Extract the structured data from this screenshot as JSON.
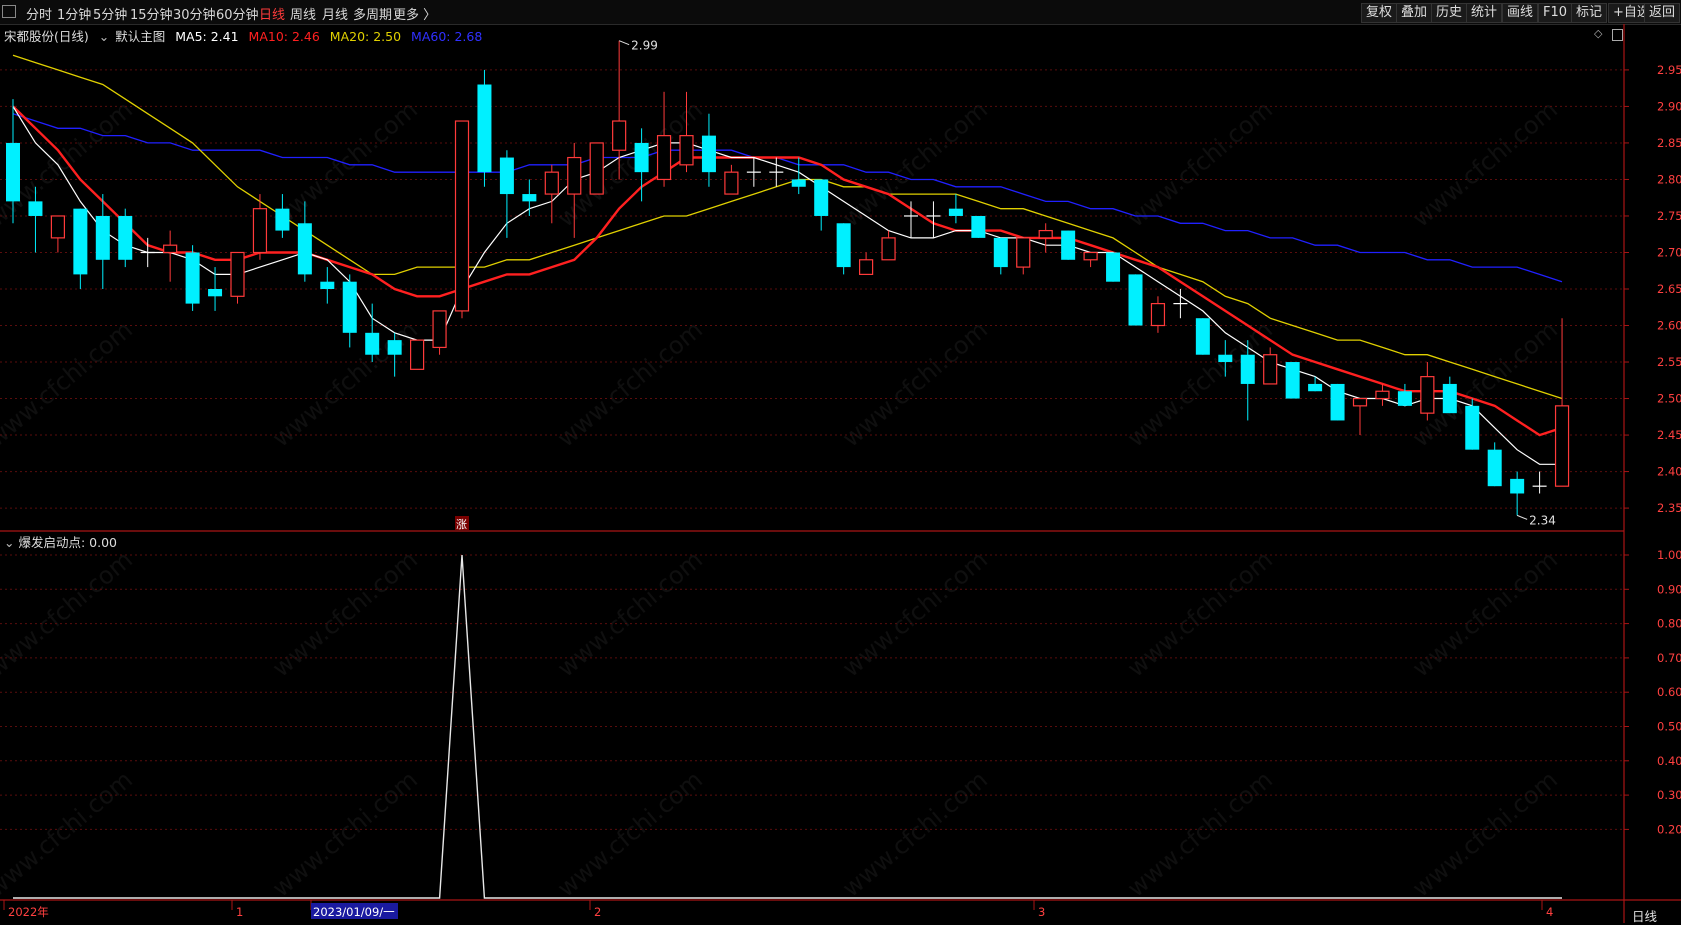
{
  "toolbar": {
    "left_items": [
      "分时",
      "1分钟",
      "5分钟",
      "15分钟",
      "30分钟",
      "60分钟",
      "日线",
      "周线",
      "月线",
      "多周期",
      "更多 〉"
    ],
    "active_item": "日线",
    "right_items": [
      "复权",
      "叠加",
      "历史",
      "统计",
      "画线",
      "F10",
      "标记",
      "+自选",
      "返回"
    ]
  },
  "main_legend": {
    "stock": "宋都股份",
    "period": "(日线)",
    "template": "默认主图",
    "ma5": "MA5: 2.41",
    "ma10": "MA10: 2.46",
    "ma20": "MA20: 2.50",
    "ma60": "MA60: 2.68"
  },
  "indicator_legend": {
    "name": "爆发启动点",
    "value": ": 0.00"
  },
  "annotations": {
    "high_label": "2.99",
    "low_label": "2.34",
    "signal_tag": "涨"
  },
  "x_axis": {
    "labels": [
      "2022年",
      "1",
      "2023/01/09/一",
      "2",
      "3",
      "4"
    ]
  },
  "timeframe_tag": "日线",
  "watermark": "www.cfchi.com",
  "colors": {
    "up": "#ff3a3a",
    "down": "#00f0ff",
    "ma5": "#ffffff",
    "ma10": "#ff2020",
    "ma20": "#e0d000",
    "ma60": "#2020ff",
    "axis": "#aa1515"
  },
  "chart_data": [
    {
      "type": "candlestick",
      "title": "宋都股份 (日线)",
      "y_ticks": [
        2.35,
        2.4,
        2.45,
        2.5,
        2.55,
        2.6,
        2.65,
        2.7,
        2.75,
        2.8,
        2.85,
        2.9,
        2.95
      ],
      "ylim": [
        2.32,
        2.98
      ],
      "candles": [
        [
          2.85,
          2.91,
          2.74,
          2.77
        ],
        [
          2.77,
          2.79,
          2.7,
          2.75
        ],
        [
          2.72,
          2.75,
          2.7,
          2.75
        ],
        [
          2.76,
          2.76,
          2.65,
          2.67
        ],
        [
          2.75,
          2.78,
          2.65,
          2.69
        ],
        [
          2.75,
          2.76,
          2.68,
          2.69
        ],
        [
          2.7,
          2.72,
          2.68,
          2.7
        ],
        [
          2.7,
          2.73,
          2.66,
          2.71
        ],
        [
          2.7,
          2.71,
          2.62,
          2.63
        ],
        [
          2.65,
          2.68,
          2.62,
          2.64
        ],
        [
          2.64,
          2.7,
          2.63,
          2.7
        ],
        [
          2.7,
          2.78,
          2.69,
          2.76
        ],
        [
          2.76,
          2.78,
          2.72,
          2.73
        ],
        [
          2.74,
          2.77,
          2.66,
          2.67
        ],
        [
          2.66,
          2.68,
          2.63,
          2.65
        ],
        [
          2.66,
          2.67,
          2.57,
          2.59
        ],
        [
          2.59,
          2.63,
          2.55,
          2.56
        ],
        [
          2.58,
          2.59,
          2.53,
          2.56
        ],
        [
          2.54,
          2.58,
          2.54,
          2.58
        ],
        [
          2.57,
          2.62,
          2.56,
          2.62
        ],
        [
          2.62,
          2.88,
          2.61,
          2.88
        ],
        [
          2.93,
          2.95,
          2.79,
          2.81
        ],
        [
          2.83,
          2.84,
          2.72,
          2.78
        ],
        [
          2.78,
          2.8,
          2.75,
          2.77
        ],
        [
          2.78,
          2.82,
          2.74,
          2.81
        ],
        [
          2.78,
          2.85,
          2.72,
          2.83
        ],
        [
          2.78,
          2.85,
          2.78,
          2.85
        ],
        [
          2.84,
          2.99,
          2.8,
          2.88
        ],
        [
          2.85,
          2.87,
          2.77,
          2.81
        ],
        [
          2.8,
          2.92,
          2.79,
          2.86
        ],
        [
          2.82,
          2.92,
          2.81,
          2.86
        ],
        [
          2.86,
          2.89,
          2.79,
          2.81
        ],
        [
          2.78,
          2.82,
          2.78,
          2.81
        ],
        [
          2.81,
          2.83,
          2.79,
          2.81
        ],
        [
          2.81,
          2.83,
          2.79,
          2.81
        ],
        [
          2.8,
          2.83,
          2.78,
          2.79
        ],
        [
          2.8,
          2.8,
          2.73,
          2.75
        ],
        [
          2.74,
          2.74,
          2.67,
          2.68
        ],
        [
          2.67,
          2.7,
          2.67,
          2.69
        ],
        [
          2.69,
          2.73,
          2.69,
          2.72
        ],
        [
          2.75,
          2.77,
          2.72,
          2.75
        ],
        [
          2.75,
          2.77,
          2.72,
          2.75
        ],
        [
          2.76,
          2.78,
          2.74,
          2.75
        ],
        [
          2.75,
          2.75,
          2.72,
          2.72
        ],
        [
          2.72,
          2.72,
          2.67,
          2.68
        ],
        [
          2.68,
          2.72,
          2.67,
          2.72
        ],
        [
          2.72,
          2.74,
          2.7,
          2.73
        ],
        [
          2.73,
          2.73,
          2.69,
          2.69
        ],
        [
          2.69,
          2.7,
          2.68,
          2.7
        ],
        [
          2.7,
          2.7,
          2.66,
          2.66
        ],
        [
          2.67,
          2.67,
          2.6,
          2.6
        ],
        [
          2.6,
          2.64,
          2.59,
          2.63
        ],
        [
          2.63,
          2.65,
          2.61,
          2.63
        ],
        [
          2.61,
          2.61,
          2.56,
          2.56
        ],
        [
          2.56,
          2.58,
          2.53,
          2.55
        ],
        [
          2.56,
          2.58,
          2.47,
          2.52
        ],
        [
          2.52,
          2.57,
          2.52,
          2.56
        ],
        [
          2.55,
          2.55,
          2.5,
          2.5
        ],
        [
          2.52,
          2.53,
          2.51,
          2.51
        ],
        [
          2.52,
          2.52,
          2.47,
          2.47
        ],
        [
          2.49,
          2.5,
          2.45,
          2.5
        ],
        [
          2.5,
          2.52,
          2.49,
          2.51
        ],
        [
          2.51,
          2.52,
          2.49,
          2.49
        ],
        [
          2.48,
          2.55,
          2.47,
          2.53
        ],
        [
          2.52,
          2.53,
          2.48,
          2.48
        ],
        [
          2.49,
          2.5,
          2.43,
          2.43
        ],
        [
          2.43,
          2.44,
          2.38,
          2.38
        ],
        [
          2.39,
          2.4,
          2.34,
          2.37
        ],
        [
          2.38,
          2.4,
          2.37,
          2.38
        ],
        [
          2.38,
          2.61,
          2.38,
          2.49
        ]
      ],
      "ma5": [
        2.9,
        2.85,
        2.82,
        2.77,
        2.73,
        2.71,
        2.7,
        2.7,
        2.69,
        2.67,
        2.67,
        2.68,
        2.69,
        2.7,
        2.69,
        2.66,
        2.61,
        2.59,
        2.58,
        2.58,
        2.65,
        2.7,
        2.74,
        2.76,
        2.77,
        2.8,
        2.81,
        2.83,
        2.84,
        2.85,
        2.85,
        2.84,
        2.83,
        2.83,
        2.82,
        2.81,
        2.79,
        2.77,
        2.75,
        2.73,
        2.72,
        2.72,
        2.73,
        2.73,
        2.72,
        2.72,
        2.71,
        2.71,
        2.7,
        2.7,
        2.68,
        2.66,
        2.64,
        2.62,
        2.59,
        2.57,
        2.55,
        2.54,
        2.53,
        2.51,
        2.5,
        2.5,
        2.49,
        2.5,
        2.5,
        2.49,
        2.46,
        2.43,
        2.41,
        2.41
      ],
      "ma10": [
        2.9,
        2.87,
        2.84,
        2.8,
        2.77,
        2.74,
        2.71,
        2.7,
        2.7,
        2.69,
        2.69,
        2.7,
        2.7,
        2.7,
        2.69,
        2.68,
        2.67,
        2.65,
        2.64,
        2.64,
        2.65,
        2.66,
        2.67,
        2.67,
        2.68,
        2.69,
        2.72,
        2.76,
        2.79,
        2.81,
        2.83,
        2.83,
        2.83,
        2.83,
        2.83,
        2.83,
        2.82,
        2.8,
        2.79,
        2.78,
        2.76,
        2.74,
        2.73,
        2.73,
        2.73,
        2.72,
        2.72,
        2.72,
        2.71,
        2.7,
        2.69,
        2.68,
        2.66,
        2.64,
        2.62,
        2.6,
        2.58,
        2.56,
        2.55,
        2.54,
        2.53,
        2.52,
        2.51,
        2.51,
        2.51,
        2.5,
        2.49,
        2.47,
        2.45,
        2.46
      ],
      "ma20": [
        2.97,
        2.96,
        2.95,
        2.94,
        2.93,
        2.91,
        2.89,
        2.87,
        2.85,
        2.82,
        2.79,
        2.77,
        2.75,
        2.73,
        2.71,
        2.69,
        2.67,
        2.67,
        2.68,
        2.68,
        2.68,
        2.68,
        2.69,
        2.69,
        2.7,
        2.71,
        2.72,
        2.73,
        2.74,
        2.75,
        2.75,
        2.76,
        2.77,
        2.78,
        2.79,
        2.8,
        2.8,
        2.79,
        2.79,
        2.78,
        2.78,
        2.78,
        2.78,
        2.77,
        2.76,
        2.76,
        2.75,
        2.74,
        2.73,
        2.72,
        2.7,
        2.68,
        2.67,
        2.66,
        2.64,
        2.63,
        2.61,
        2.6,
        2.59,
        2.58,
        2.58,
        2.57,
        2.56,
        2.56,
        2.55,
        2.54,
        2.53,
        2.52,
        2.51,
        2.5
      ],
      "ma60": [
        2.89,
        2.88,
        2.87,
        2.87,
        2.86,
        2.86,
        2.85,
        2.85,
        2.84,
        2.84,
        2.84,
        2.84,
        2.83,
        2.83,
        2.83,
        2.82,
        2.82,
        2.81,
        2.81,
        2.81,
        2.81,
        2.81,
        2.81,
        2.82,
        2.82,
        2.82,
        2.83,
        2.83,
        2.83,
        2.84,
        2.84,
        2.84,
        2.84,
        2.83,
        2.83,
        2.82,
        2.82,
        2.82,
        2.81,
        2.81,
        2.8,
        2.8,
        2.79,
        2.79,
        2.79,
        2.78,
        2.77,
        2.77,
        2.76,
        2.76,
        2.75,
        2.75,
        2.74,
        2.74,
        2.73,
        2.73,
        2.72,
        2.72,
        2.71,
        2.71,
        2.7,
        2.7,
        2.7,
        2.69,
        2.69,
        2.68,
        2.68,
        2.68,
        2.67,
        2.66
      ]
    },
    {
      "type": "line",
      "series": [
        {
          "name": "爆发启动点",
          "values": [
            0,
            0,
            0,
            0,
            0,
            0,
            0,
            0,
            0,
            0,
            0,
            0,
            0,
            0,
            0,
            0,
            0,
            0,
            0,
            0,
            1,
            0,
            0,
            0,
            0,
            0,
            0,
            0,
            0,
            0,
            0,
            0,
            0,
            0,
            0,
            0,
            0,
            0,
            0,
            0,
            0,
            0,
            0,
            0,
            0,
            0,
            0,
            0,
            0,
            0,
            0,
            0,
            0,
            0,
            0,
            0,
            0,
            0,
            0,
            0,
            0,
            0,
            0,
            0,
            0,
            0,
            0,
            0,
            0,
            0
          ]
        }
      ],
      "y_ticks": [
        0.2,
        0.3,
        0.4,
        0.5,
        0.6,
        0.7,
        0.8,
        0.9,
        1.0
      ],
      "ylim": [
        0,
        1.0
      ]
    }
  ]
}
